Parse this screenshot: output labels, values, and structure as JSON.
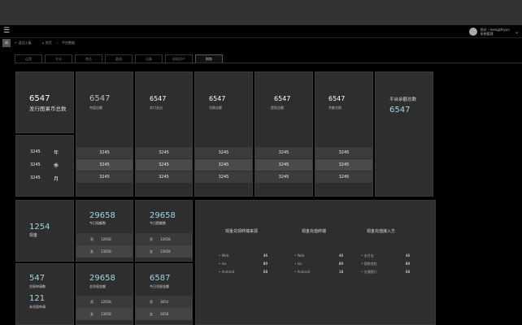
{
  "header": {
    "menu_icon": "menu-icon",
    "user_name": "测试 · mengzhiyun",
    "user_role": "系统管理",
    "chevron": "⌄"
  },
  "breadcrumb": {
    "back": "返回上级",
    "home": "首页",
    "sep": "›",
    "current": "平台数据"
  },
  "tabs": [
    "运营",
    "文化",
    "商品",
    "渠道",
    "设备",
    "虚拟资产",
    "财务"
  ],
  "active_tab": "财务",
  "issued": {
    "value": "6547",
    "label": "发行图果币总数"
  },
  "period": [
    {
      "value": "3245",
      "unit": "年"
    },
    {
      "value": "3245",
      "unit": "季"
    },
    {
      "value": "3245",
      "unit": "月"
    }
  ],
  "columns": [
    {
      "value": "6547",
      "label": "充值总额",
      "rows": [
        "3245",
        "3245",
        "3245"
      ]
    },
    {
      "value": "6547",
      "label": "实付支出",
      "rows": [
        "3245",
        "3245",
        "3245"
      ]
    },
    {
      "value": "6547",
      "label": "兑换总额",
      "rows": [
        "3245",
        "3245",
        "3245"
      ]
    },
    {
      "value": "6547",
      "label": "提现总额",
      "rows": [
        "3245",
        "3245",
        "3245"
      ]
    },
    {
      "value": "6547",
      "label": "余额兑换",
      "rows": [
        "3245",
        "3245",
        "3245"
      ]
    }
  ],
  "platform": {
    "label": "平台余额总数",
    "value": "6547"
  },
  "cash": {
    "value": "1254",
    "label": "现金"
  },
  "apply": {
    "value1": "547",
    "label1": "兑现申请数",
    "value2": "121",
    "label2": "未兑现申请"
  },
  "stats": [
    {
      "value": "29658",
      "label": "今日现额数",
      "rows": [
        {
          "k": "男",
          "v": "12658"
        },
        {
          "k": "女",
          "v": "13658"
        }
      ]
    },
    {
      "value": "29658",
      "label": "今日提额数",
      "rows": [
        {
          "k": "男",
          "v": "12658"
        },
        {
          "k": "女",
          "v": "13658"
        }
      ]
    },
    {
      "value": "29658",
      "label": "总兑现金额",
      "rows": [
        {
          "k": "男",
          "v": "12658"
        },
        {
          "k": "女",
          "v": "13658"
        }
      ]
    },
    {
      "value": "6587",
      "label": "今日兑现金额",
      "rows": [
        {
          "k": "男",
          "v": "3654"
        },
        {
          "k": "女",
          "v": "2658"
        }
      ]
    }
  ],
  "sources": [
    {
      "title": "现金兑现终端来源",
      "items": [
        {
          "n": "Web",
          "v": "46"
        },
        {
          "n": "Ios",
          "v": "89"
        },
        {
          "n": "Android",
          "v": "68"
        }
      ]
    },
    {
      "title": "现金充值终端",
      "items": [
        {
          "n": "Web",
          "v": "46"
        },
        {
          "n": "Ios",
          "v": "89"
        },
        {
          "n": "Android",
          "v": "18"
        }
      ]
    },
    {
      "title": "现金充值接入方",
      "items": [
        {
          "n": "支付宝",
          "v": "46"
        },
        {
          "n": "银联钱包",
          "v": "89"
        },
        {
          "n": "交通银行",
          "v": "68"
        }
      ]
    }
  ]
}
